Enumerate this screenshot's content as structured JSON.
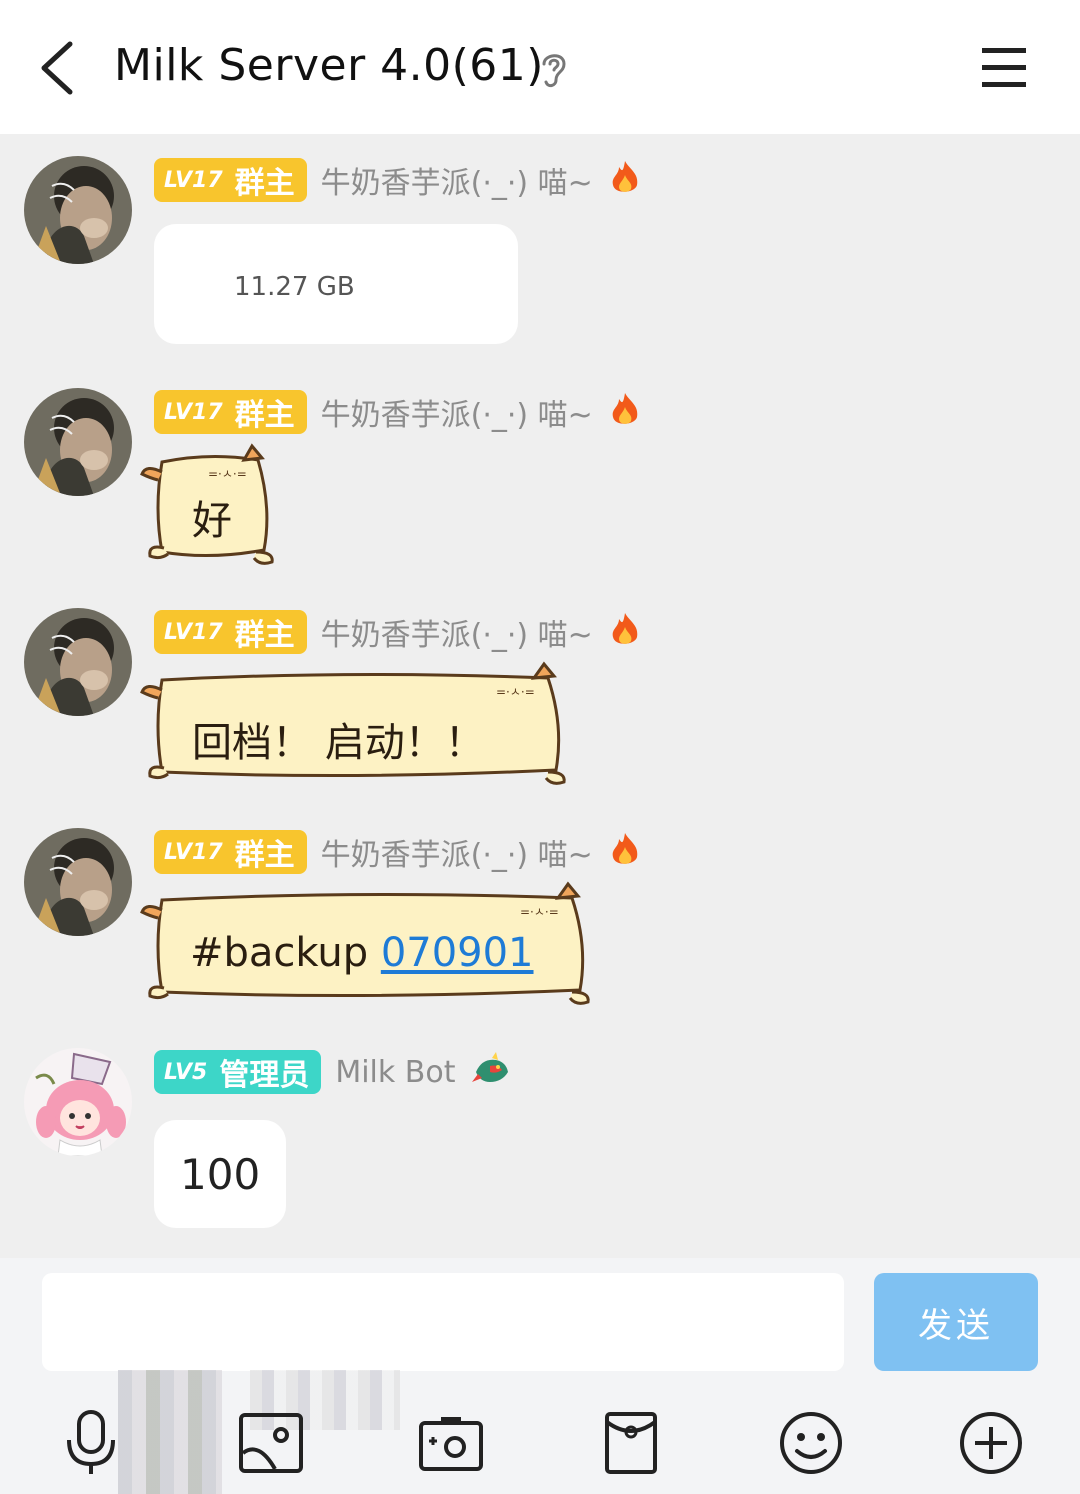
{
  "header": {
    "title": "Milk Server 4.0(61)"
  },
  "messages": [
    {
      "lv": "LV17",
      "role": "群主",
      "sender": "牛奶香芋派(·_·) 喵~",
      "text": "11.27 GB"
    },
    {
      "lv": "LV17",
      "role": "群主",
      "sender": "牛奶香芋派(·_·) 喵~",
      "text": "好"
    },
    {
      "lv": "LV17",
      "role": "群主",
      "sender": "牛奶香芋派(·_·) 喵~",
      "text": "回档！  启动！！"
    },
    {
      "lv": "LV17",
      "role": "群主",
      "sender": "牛奶香芋派(·_·) 喵~",
      "text": "#backup",
      "link": "070901"
    },
    {
      "lv": "LV5",
      "role": "管理员",
      "sender": "Milk Bot",
      "text": "100"
    }
  ],
  "composer": {
    "placeholder": "",
    "send_label": "发送"
  },
  "toolbar": {
    "icons": [
      "microphone-icon",
      "image-icon",
      "camera-icon",
      "red-packet-icon",
      "emoji-icon",
      "plus-icon"
    ]
  },
  "colors": {
    "owner_badge": "#f8c52d",
    "admin_badge": "#3dd6c8",
    "send_button": "#7fc1f2",
    "cat_bubble_fill": "#fdf2c4",
    "cat_bubble_stroke": "#5a3b1c",
    "link": "#1e7bd6"
  }
}
